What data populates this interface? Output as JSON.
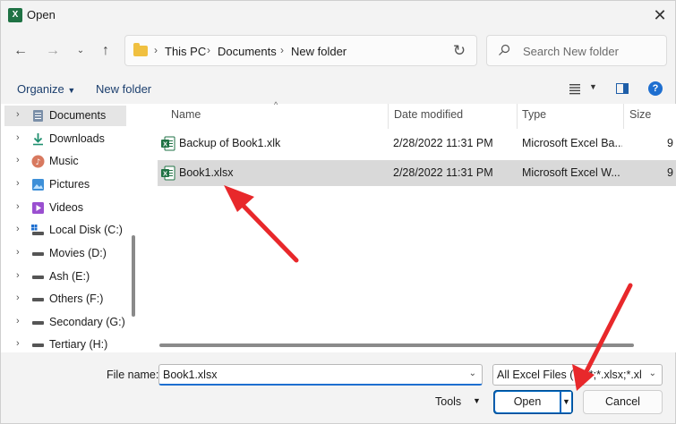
{
  "window": {
    "title": "Open",
    "app_icon": "excel-icon",
    "close_icon": "close-icon"
  },
  "navigation": {
    "back_icon": "arrow-left-icon",
    "forward_icon": "arrow-right-icon",
    "recent_icon": "chevron-down-icon",
    "up_icon": "arrow-up-icon"
  },
  "address": {
    "crumbs": [
      "This PC",
      "Documents",
      "New folder"
    ],
    "refresh_icon": "refresh-icon"
  },
  "search": {
    "placeholder": "Search New folder"
  },
  "toolbar": {
    "organize_label": "Organize",
    "new_folder_label": "New folder",
    "help_glyph": "?"
  },
  "sidebar": {
    "items": [
      {
        "label": "Documents",
        "icon": "documents-icon",
        "selected": true
      },
      {
        "label": "Downloads",
        "icon": "downloads-icon"
      },
      {
        "label": "Music",
        "icon": "music-icon"
      },
      {
        "label": "Pictures",
        "icon": "pictures-icon"
      },
      {
        "label": "Videos",
        "icon": "videos-icon"
      },
      {
        "label": "Local Disk (C:)",
        "icon": "windows-drive-icon"
      },
      {
        "label": "Movies (D:)",
        "icon": "drive-icon"
      },
      {
        "label": "Ash (E:)",
        "icon": "drive-icon"
      },
      {
        "label": "Others (F:)",
        "icon": "drive-icon"
      },
      {
        "label": "Secondary (G:)",
        "icon": "drive-icon"
      },
      {
        "label": "Tertiary (H:)",
        "icon": "drive-icon"
      }
    ]
  },
  "file_list": {
    "columns": [
      "Name",
      "Date modified",
      "Type",
      "Size"
    ],
    "rows": [
      {
        "name": "Backup of Book1.xlk",
        "date": "2/28/2022 11:31 PM",
        "type": "Microsoft Excel Ba...",
        "size": "9"
      },
      {
        "name": "Book1.xlsx",
        "date": "2/28/2022 11:31 PM",
        "type": "Microsoft Excel W...",
        "size": "9",
        "selected": true
      }
    ]
  },
  "footer": {
    "file_name_label": "File name:",
    "file_name_value": "Book1.xlsx",
    "filter_value": "All Excel Files (*.xl*;*.xlsx;*.xlsm;",
    "tools_label": "Tools",
    "open_label": "Open",
    "cancel_label": "Cancel"
  },
  "colors": {
    "accent": "#0067c0",
    "excel_green": "#1f7244",
    "annotation_arrow": "#e8282b"
  }
}
